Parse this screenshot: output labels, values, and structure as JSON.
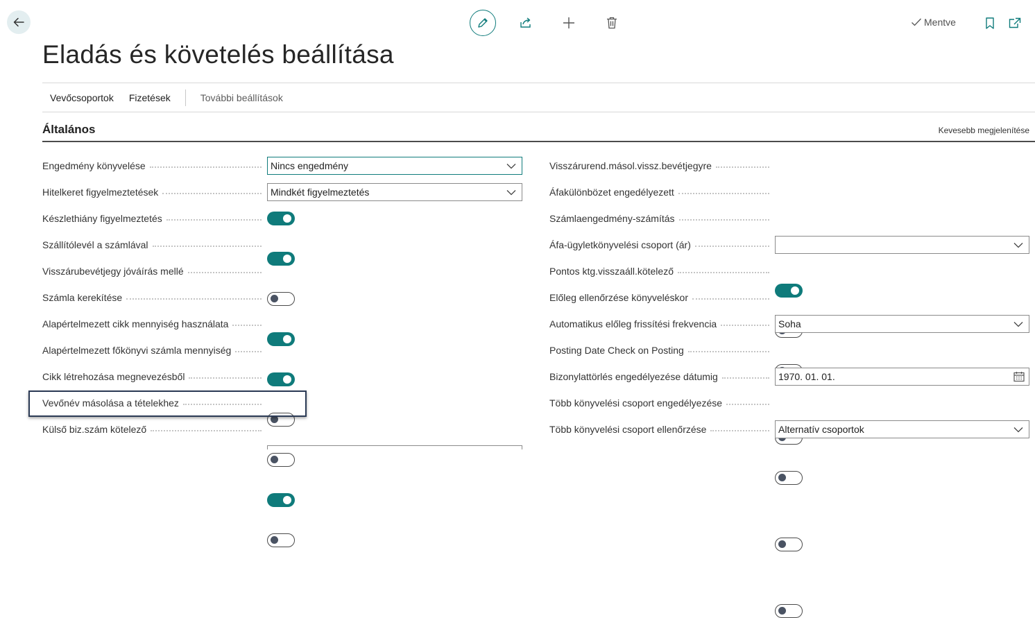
{
  "page": {
    "title": "Eladás és követelés beállítása",
    "saved_label": "Mentve"
  },
  "actions": {
    "customer_groups": "Vevőcsoportok",
    "payments": "Fizetések",
    "more_settings": "További beállítások"
  },
  "section": {
    "title": "Általános",
    "show_less": "Kevesebb megjelenítése"
  },
  "left_fields": [
    {
      "label": "Engedmény könyvelése",
      "type": "select",
      "value": "Nincs engedmény",
      "focused": true
    },
    {
      "label": "Hitelkeret figyelmeztetések",
      "type": "select",
      "value": "Mindkét figyelmeztetés"
    },
    {
      "label": "Készlethiány figyelmeztetés",
      "type": "toggle",
      "value": true
    },
    {
      "label": "Szállítólevél a számlával",
      "type": "toggle",
      "value": true
    },
    {
      "label": "Visszárubevétjegy jóváírás mellé",
      "type": "toggle",
      "value": false
    },
    {
      "label": "Számla kerekítése",
      "type": "toggle",
      "value": true
    },
    {
      "label": "Alapértelmezett cikk mennyiség használata",
      "type": "toggle",
      "value": true
    },
    {
      "label": "Alapértelmezett főkönyvi számla mennyiség",
      "type": "toggle",
      "value": false
    },
    {
      "label": "Cikk létrehozása megnevezésből",
      "type": "toggle",
      "value": false
    },
    {
      "label": "Vevőnév másolása a tételekhez",
      "type": "toggle",
      "value": true,
      "highlighted": true
    },
    {
      "label": "Külső biz.szám kötelező",
      "type": "toggle",
      "value": false
    }
  ],
  "right_fields": [
    {
      "label": "Visszárurend.másol.vissz.bevétjegyre",
      "type": "toggle",
      "value": true
    },
    {
      "label": "Áfakülönbözet engedélyezett",
      "type": "toggle",
      "value": false
    },
    {
      "label": "Számlaengedmény-számítás",
      "type": "toggle",
      "value": false
    },
    {
      "label": "Áfa-ügyletkönyvelési csoport (ár)",
      "type": "select",
      "value": ""
    },
    {
      "label": "Pontos ktg.visszaáll.kötelező",
      "type": "toggle",
      "value": false
    },
    {
      "label": "Előleg ellenőrzése könyveléskor",
      "type": "toggle",
      "value": false
    },
    {
      "label": "Automatikus előleg frissítési frekvencia",
      "type": "select",
      "value": "Soha"
    },
    {
      "label": "Posting Date Check on Posting",
      "type": "toggle",
      "value": false
    },
    {
      "label": "Bizonylattörlés engedélyezése dátumig",
      "type": "date",
      "value": "1970. 01. 01."
    },
    {
      "label": "Több könyvelési csoport engedélyezése",
      "type": "toggle",
      "value": false
    },
    {
      "label": "Több könyvelési csoport ellenőrzése",
      "type": "select",
      "value": "Alternatív csoportok"
    }
  ],
  "colors": {
    "accent": "#0f7b7b",
    "toggle_off_knob": "#4a5363",
    "highlight_border": "#2b3a55"
  },
  "icons": {
    "back": "arrow-left-icon",
    "edit": "pencil-icon",
    "share": "share-icon",
    "new": "plus-icon",
    "delete": "trash-icon",
    "saved": "checkmark-icon",
    "bookmark": "bookmark-icon",
    "popout": "popout-icon",
    "dropdown": "chevron-down-icon",
    "calendar": "calendar-icon"
  }
}
